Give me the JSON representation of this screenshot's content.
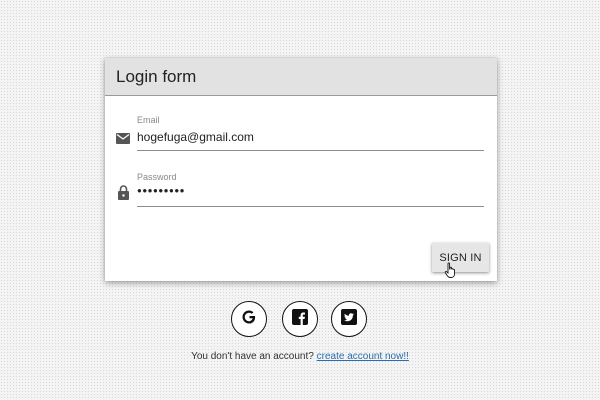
{
  "login_form": {
    "title": "Login form",
    "email": {
      "label": "Email",
      "value": "hogefuga@gmail.com",
      "icon": "envelope-icon"
    },
    "password": {
      "label": "Password",
      "value": "●●●●●●●●●",
      "icon": "lock-icon"
    },
    "signin_label": "SIGN IN"
  },
  "social": [
    {
      "name": "google",
      "icon": "google-icon"
    },
    {
      "name": "facebook",
      "icon": "facebook-icon"
    },
    {
      "name": "twitter",
      "icon": "twitter-icon"
    }
  ],
  "footer": {
    "text": "You don't have an account?",
    "link": "create account now!!"
  },
  "colors": {
    "header_bg": "#e2e2e2",
    "link": "#2a6fb0",
    "button_bg": "#e6e6e6"
  }
}
